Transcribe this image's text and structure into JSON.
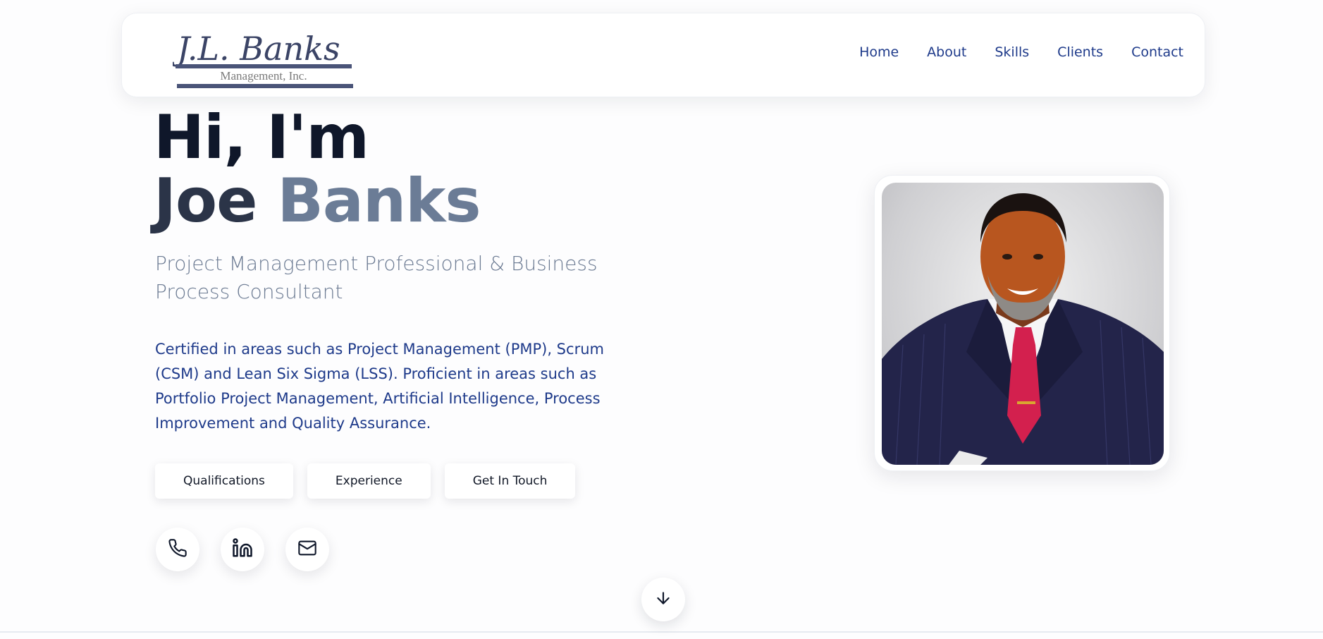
{
  "logo": {
    "script_text": "J.L. Banks",
    "sub_text": "Management, Inc."
  },
  "nav": {
    "items": [
      "Home",
      "About",
      "Skills",
      "Clients",
      "Contact"
    ]
  },
  "hero": {
    "greeting": "Hi, I'm",
    "first_name": "Joe",
    "last_name": "Banks",
    "subtitle": "Project Management Professional & Business Process Consultant",
    "description": "Certified in areas such as Project Management (PMP), Scrum (CSM) and Lean Six Sigma (LSS). Proficient in areas such as Portfolio Project Management, Artificial Intelligence, Process Improvement and Quality Assurance.",
    "buttons": [
      "Qualifications",
      "Experience",
      "Get In Touch"
    ]
  },
  "socials": {
    "icons": [
      "phone-icon",
      "linkedin-icon",
      "mail-icon"
    ]
  },
  "scroll": {
    "icon": "arrow-down-icon"
  },
  "colors": {
    "nav_link": "#1e3a8a",
    "heading_dark": "#0f172a",
    "heading_gray": "#6b7c96",
    "body_text": "#1e3a8a"
  }
}
